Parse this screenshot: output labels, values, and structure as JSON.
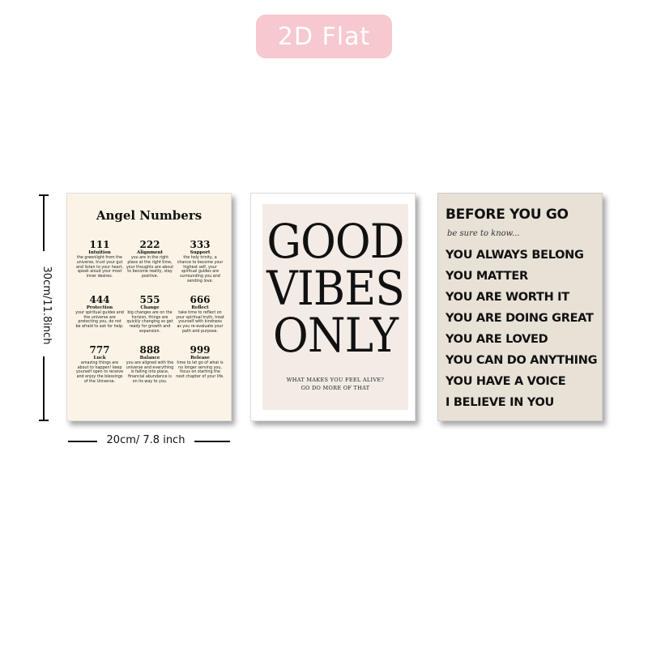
{
  "badge": {
    "label": "2D Flat",
    "color": "#f6c8d0"
  },
  "dimensions": {
    "height_label": "30cm/11.8inch",
    "width_label": "20cm/ 7.8 inch"
  },
  "poster1": {
    "title": "Angel Numbers",
    "items": [
      {
        "num": "111",
        "name": "Intuition",
        "desc": "the greenlight from the universe, trust your gut and listen to your heart, speak aloud your most inner desires."
      },
      {
        "num": "222",
        "name": "Alignment",
        "desc": "you are in the right place at the right time, your thoughts are about to become reality, stay positive."
      },
      {
        "num": "333",
        "name": "Support",
        "desc": "the holy trinity, a chance to become your highest self, your spiritual guides are surrounding you and sending love."
      },
      {
        "num": "444",
        "name": "Protection",
        "desc": "your spiritual guides and the universe are protecting you, do not be afraid to ask for help."
      },
      {
        "num": "555",
        "name": "Change",
        "desc": "big changes are on the horizon, things are quickly changing so get ready for growth and expansion."
      },
      {
        "num": "666",
        "name": "Reflect",
        "desc": "take time to reflect on your spiritual truth, treat yourself with kindness as you re-evaluate your path and purpose."
      },
      {
        "num": "777",
        "name": "Luck",
        "desc": "amazing things are about to happen! keep yourself open to receive and enjoy the blessings of the Universe."
      },
      {
        "num": "888",
        "name": "Balance",
        "desc": "you are aligned with the universe and everything is falling into place, financial abundance is on its way to you."
      },
      {
        "num": "999",
        "name": "Release",
        "desc": "time to let go of what is no longer serving you, focus on starting the next chapter of your life."
      }
    ]
  },
  "poster2": {
    "line1": "GOOD",
    "line2": "VIBES",
    "line3": "ONLY",
    "sub1": "WHAT MAKES YOU FEEL ALIVE?",
    "sub2": "GO DO MORE OF THAT"
  },
  "poster3": {
    "heading": "BEFORE YOU GO",
    "script": "be sure to know...",
    "lines": [
      "YOU ALWAYS BELONG",
      "YOU MATTER",
      "YOU ARE WORTH IT",
      "YOU ARE DOING GREAT",
      "YOU ARE LOVED",
      "YOU CAN DO ANYTHING",
      "YOU HAVE A VOICE",
      "I BELIEVE IN YOU"
    ]
  }
}
